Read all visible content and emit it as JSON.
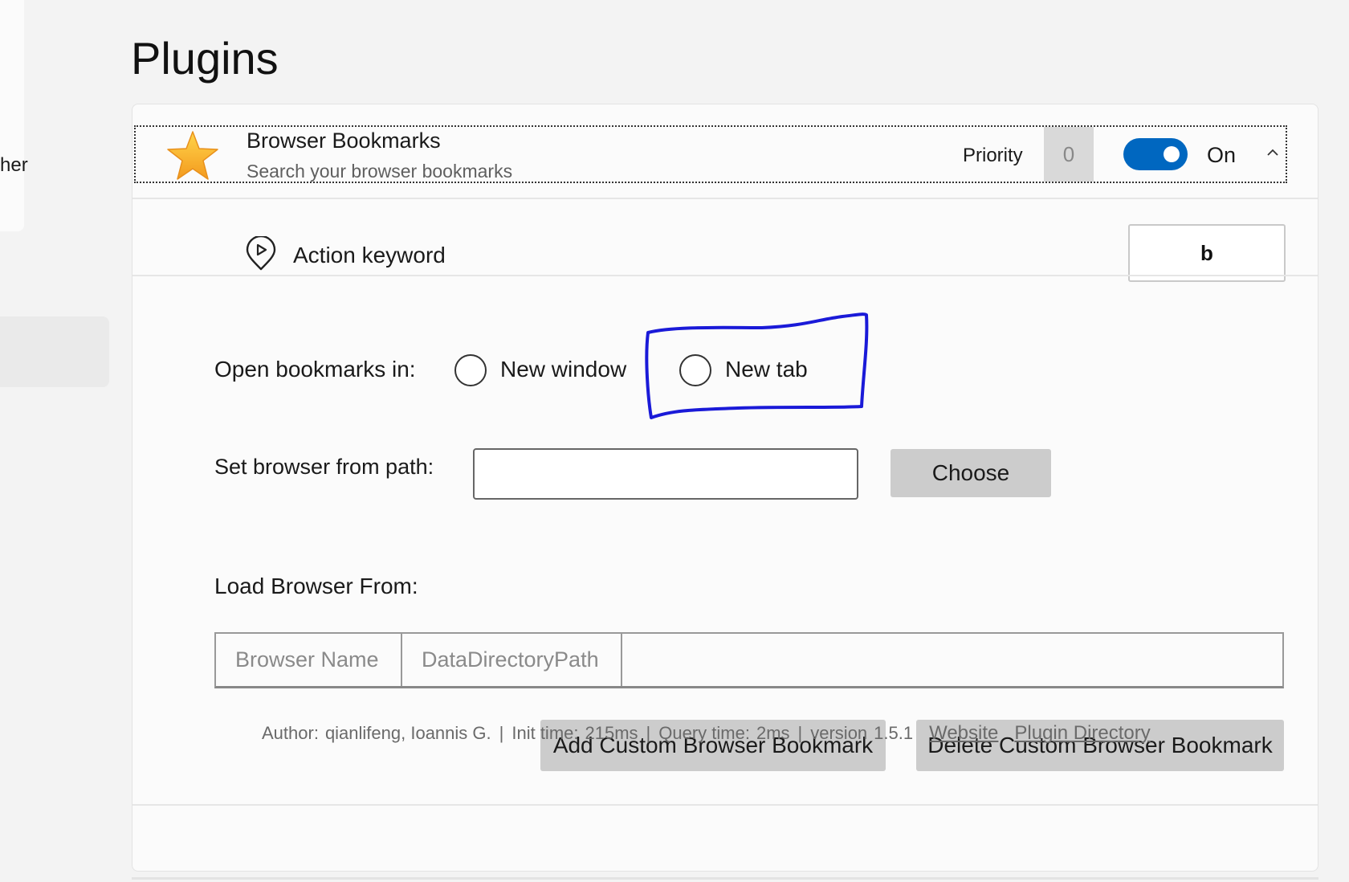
{
  "sidebar": {
    "partial_label": "her"
  },
  "page": {
    "title": "Plugins"
  },
  "plugin": {
    "name": "Browser Bookmarks",
    "description": "Search your browser bookmarks",
    "icon": "star-icon",
    "priority_label": "Priority",
    "priority_value": "0",
    "toggle_state": "On",
    "enabled": true
  },
  "keyword": {
    "label": "Action keyword",
    "value": "b",
    "icon": "action-keyword-icon"
  },
  "settings": {
    "open_label": "Open bookmarks in:",
    "options": [
      "New window",
      "New tab"
    ],
    "selected": null,
    "path_label": "Set browser from path:",
    "path_value": "",
    "choose_label": "Choose",
    "load_label": "Load Browser From:",
    "columns": [
      "Browser Name",
      "DataDirectoryPath"
    ],
    "add_label": "Add Custom Browser Bookmark",
    "delete_label": "Delete Custom Browser Bookmark"
  },
  "footer": {
    "author_label": "Author:",
    "author": "qianlifeng, Ioannis G.",
    "init_label": "Init time:",
    "init_value": "215ms",
    "query_label": "Query time:",
    "query_value": "2ms",
    "version_label": "version",
    "version_value": "1.5.1",
    "website_link": "Website",
    "directory_link": "Plugin Directory"
  },
  "colors": {
    "accent": "#0067c0",
    "highlight": "#1a1ad8",
    "star": "#f6a623"
  }
}
